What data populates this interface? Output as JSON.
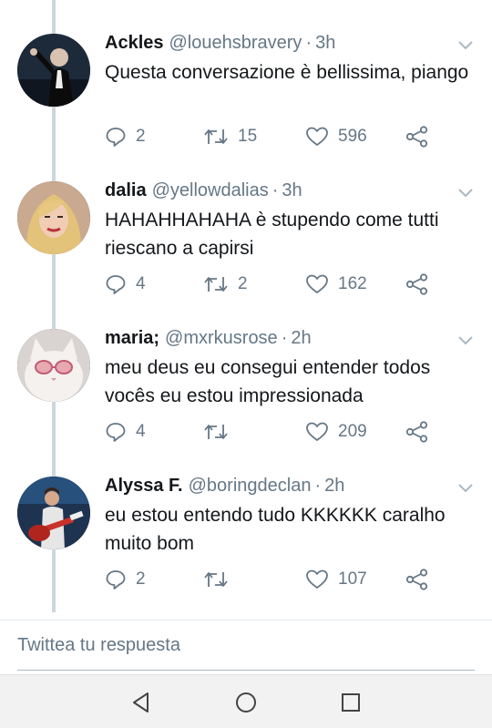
{
  "tweets": [
    {
      "name": "Ackles",
      "handle": "@louehsbravery",
      "separator": "·",
      "time": "3h",
      "text": "Questa conversazione è bellissima, piango",
      "replies": "2",
      "retweets": "15",
      "likes": "596",
      "avatar": "dark-stage-performer-avatar"
    },
    {
      "name": "dalia",
      "handle": "@yellowdalias",
      "separator": "·",
      "time": "3h",
      "text": "HAHAHHAHAHA è stupendo come tutti riescano a capirsi",
      "replies": "4",
      "retweets": "2",
      "likes": "162",
      "avatar": "blonde-woman-avatar"
    },
    {
      "name": "maria;",
      "handle": "@mxrkusrose",
      "separator": "·",
      "time": "2h",
      "text": "meu deus eu consegui entender todos vocês eu estou impressionada",
      "replies": "4",
      "retweets": "",
      "likes": "209",
      "avatar": "white-cat-sunglasses-avatar"
    },
    {
      "name": "Alyssa F.",
      "handle": "@boringdeclan",
      "separator": "·",
      "time": "2h",
      "text": "eu estou entendo tudo KKKKKK caralho muito bom",
      "replies": "2",
      "retweets": "",
      "likes": "107",
      "avatar": "guitarist-on-stage-avatar"
    }
  ],
  "reply_box": {
    "placeholder": "Twittea tu respuesta"
  },
  "colors": {
    "text": "#14171a",
    "muted": "#657786",
    "thread": "#ccd6dd"
  },
  "icons": [
    "reply-icon",
    "retweet-icon",
    "like-icon",
    "share-icon",
    "chevron-down-icon",
    "back-icon",
    "home-icon",
    "recent-apps-icon"
  ]
}
